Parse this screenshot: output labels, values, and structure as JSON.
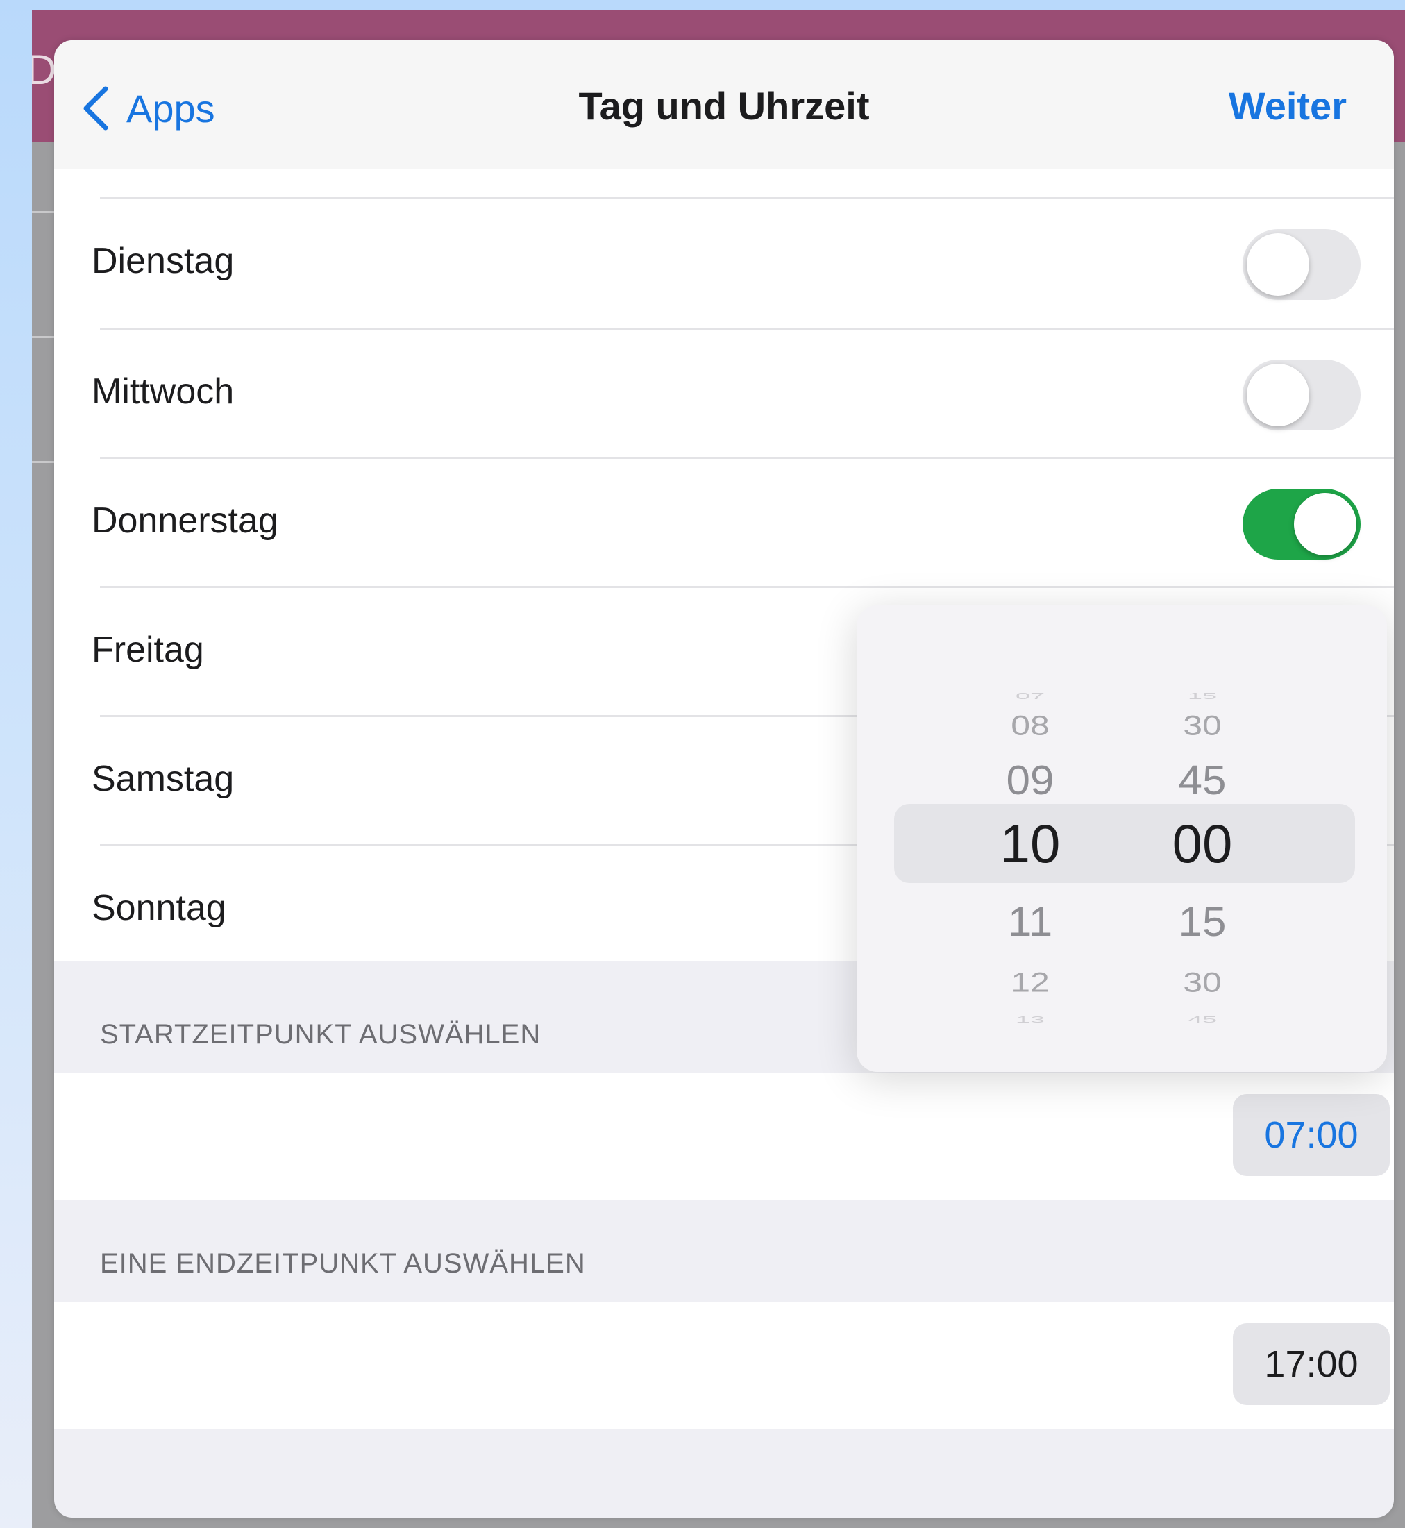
{
  "backdrop": {
    "glyph": "D"
  },
  "nav": {
    "back_label": "Apps",
    "title": "Tag und Uhrzeit",
    "next_label": "Weiter"
  },
  "days": [
    {
      "label": "Dienstag",
      "on": false
    },
    {
      "label": "Mittwoch",
      "on": false
    },
    {
      "label": "Donnerstag",
      "on": true
    },
    {
      "label": "Freitag",
      "on": null
    },
    {
      "label": "Samstag",
      "on": null
    },
    {
      "label": "Sonntag",
      "on": null
    }
  ],
  "start": {
    "header": "STARTZEITPUNKT AUSWÄHLEN",
    "value": "07:00"
  },
  "end": {
    "header": "EINE ENDZEITPUNKT AUSWÄHLEN",
    "value": "17:00"
  },
  "picker": {
    "hours": [
      "07",
      "08",
      "09",
      "10",
      "11",
      "12",
      "13"
    ],
    "minutes": [
      "15",
      "30",
      "45",
      "00",
      "15",
      "30",
      "45"
    ],
    "selected_hour": "10",
    "selected_minute": "00"
  },
  "colors": {
    "accent": "#1875e0",
    "toggle_on": "#1ea548",
    "header_bar": "#9a4d74"
  }
}
